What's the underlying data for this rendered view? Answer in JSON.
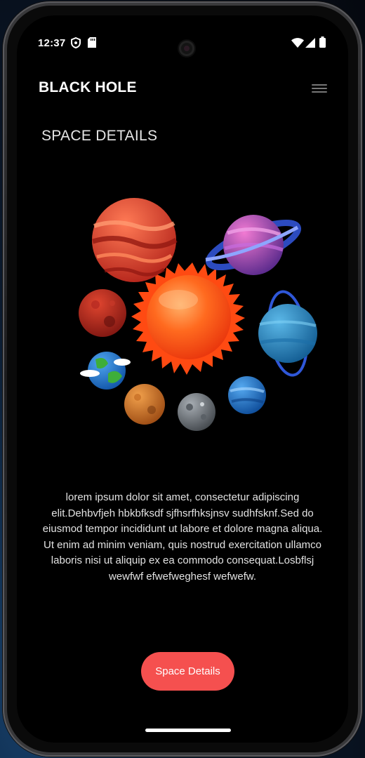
{
  "status_bar": {
    "time": "12:37",
    "icons": [
      "shield-icon",
      "sd-card-icon",
      "wifi-icon",
      "cellular-signal-icon",
      "battery-icon"
    ]
  },
  "app_bar": {
    "brand": "BLACK HOLE",
    "menu_icon": "hamburger-menu-icon"
  },
  "page": {
    "title": "SPACE DETAILS",
    "illustration": "solar-system-illustration",
    "description": "lorem ipsum dolor sit amet, consectetur adipiscing elit.Dehbvfjeh hbkbfksdf sjfhsrfhksjnsv sudhfsknf.Sed do eiusmod tempor incididunt ut labore et dolore magna aliqua. Ut enim ad minim veniam, quis nostrud exercitation ullamco laboris nisi ut aliquip ex ea commodo consequat.Losbflsj wewfwf efwefweghesf wefwefw.",
    "button_label": "Space Details"
  },
  "colors": {
    "background": "#000000",
    "accent_button": "#f5504f",
    "text": "#ffffff"
  }
}
